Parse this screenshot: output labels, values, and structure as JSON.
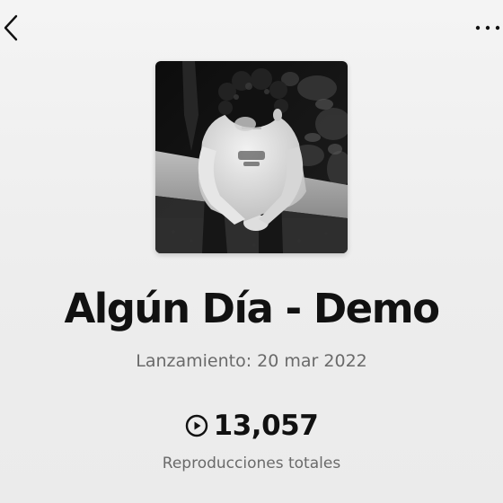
{
  "header": {
    "back_icon": "chevron-left-icon",
    "more_icon": "more-horizontal-icon"
  },
  "cover": {
    "description_icon": "album-cover-image"
  },
  "track": {
    "title": "Algún Día - Demo",
    "release": "Lanzamiento: 20 mar 2022",
    "play_count": "13,057",
    "play_count_label": "Reproducciones totales",
    "play_icon": "play-circle-icon"
  },
  "colors": {
    "background": "#f0f0f0",
    "text_primary": "#111111",
    "text_secondary": "#6a6a6a"
  }
}
